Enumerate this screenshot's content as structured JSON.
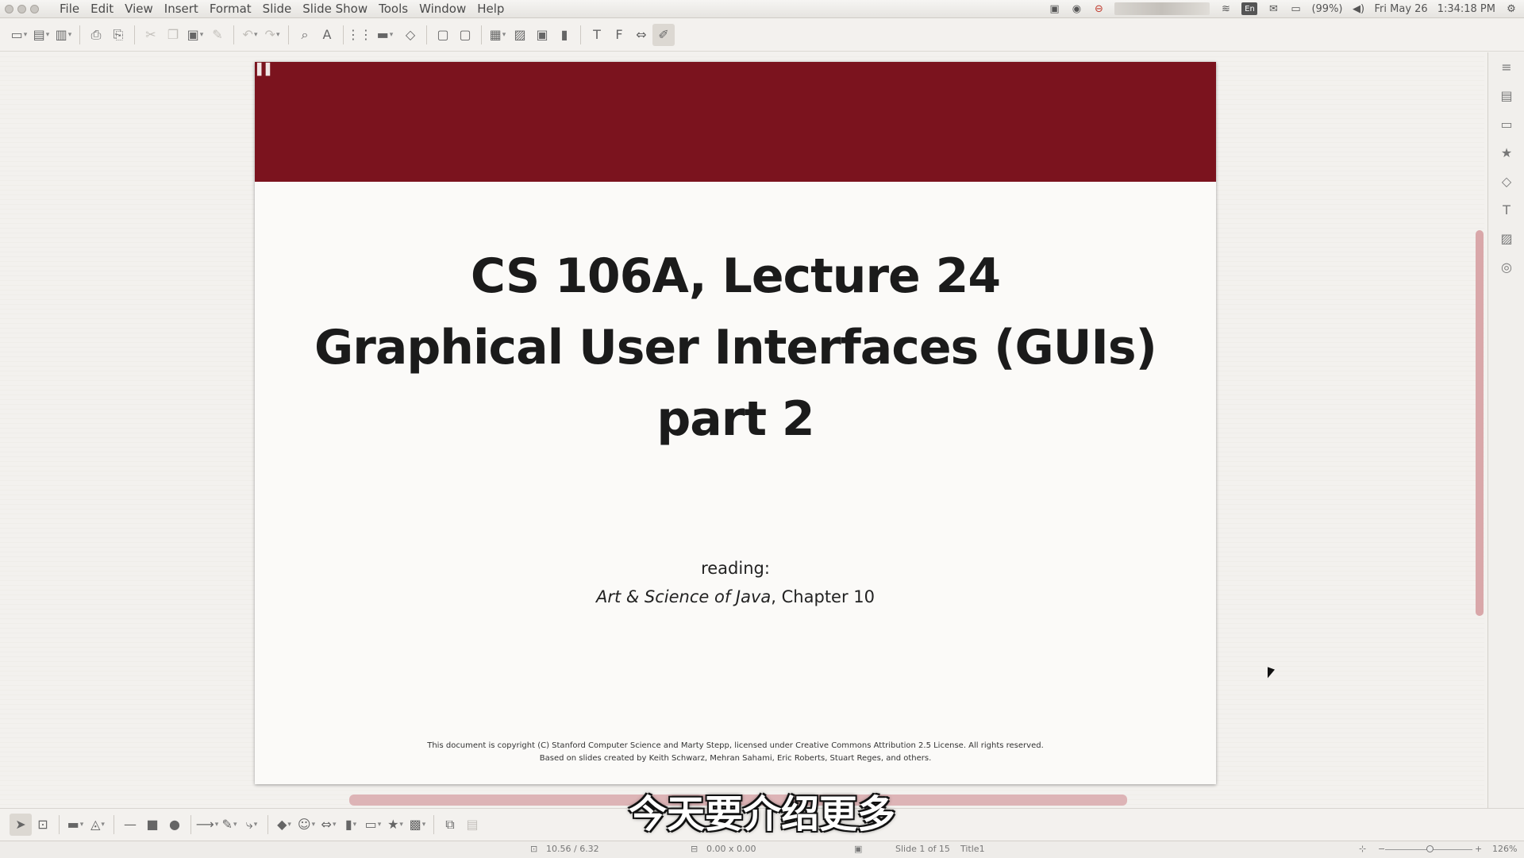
{
  "menubar": {
    "items": [
      "File",
      "Edit",
      "View",
      "Insert",
      "Format",
      "Slide",
      "Slide Show",
      "Tools",
      "Window",
      "Help"
    ],
    "tray": {
      "keyboard_layout": "En",
      "battery": "(99%)",
      "date": "Fri May 26",
      "time": "1:34:18 PM"
    }
  },
  "slide": {
    "title_line1": "CS 106A, Lecture 24",
    "title_line2": "Graphical User Interfaces (GUIs)",
    "title_line3": "part 2",
    "reading_label": "reading:",
    "reading_book": "Art & Science of Java",
    "reading_rest": ", Chapter 10",
    "copyright_line1": "This document is copyright (C) Stanford Computer Science and Marty Stepp, licensed under Creative Commons Attribution 2.5 License.  All rights reserved.",
    "copyright_line2": "Based on slides created by Keith Schwarz, Mehran Sahami, Eric Roberts, Stuart Reges, and others.",
    "header_color": "#7b131e"
  },
  "subtitle": "今天要介绍更多",
  "statusbar": {
    "position": "10.56 / 6.32",
    "size": "0.00 x 0.00",
    "slide_info": "Slide 1 of 15",
    "layout_name": "Title1",
    "zoom": "126%",
    "zoom_minus": "−",
    "zoom_plus": "+"
  }
}
